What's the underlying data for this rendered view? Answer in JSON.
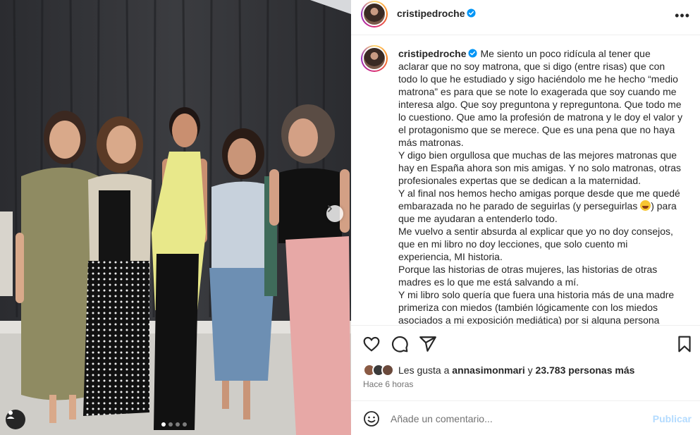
{
  "post": {
    "username": "cristipedroche",
    "verified": true,
    "more_icon": "more-horizontal-icon",
    "carousel": {
      "slide_count": 4,
      "active_index": 0
    }
  },
  "caption": {
    "username": "cristipedroche",
    "paragraphs": [
      "Me siento un poco ridícula al tener que aclarar que no soy matrona, que si digo (entre risas) que con todo lo que he estudiado y sigo haciéndolo me he hecho “medio matrona” es para que se note lo exagerada que soy cuando me interesa algo. Que soy preguntona y repreguntona. Que todo me lo cuestiono. Que amo la profesión de matrona y le doy el valor y el protagonismo que se merece. Que es una pena que no haya más matronas.",
      "Y digo bien orgullosa que muchas de las mejores matronas que hay en España ahora son mis amigas. Y no solo matronas, otras profesionales expertas que se dedican a la maternidad.",
      "Y al final nos hemos hecho amigas porque desde que me quedé embarazada no he parado de seguirlas (y perseguirlas",
      ") para que me ayudaran a entenderlo todo.",
      "Me vuelvo a sentir absurda al explicar que yo no doy consejos, que en mi libro no doy lecciones, que solo cuento mi experiencia, MI historia.",
      "Porque las historias de otras mujeres, las historias de otras madres es lo que me está salvando a mí.",
      "Y mi libro solo quería que fuera una historia más de una madre primeriza con miedos (también lógicamente con los miedos asociados a mi exposición mediática) por si alguna persona"
    ]
  },
  "likes": {
    "prefix": "Les gusta a",
    "user": "annasimonmari",
    "connector": "y",
    "others": "23.783 personas más"
  },
  "time_ago": "Hace 6 horas",
  "comment": {
    "placeholder": "Añade un comentario...",
    "post_label": "Publicar"
  },
  "colors": {
    "verified": "#0095f6",
    "post_disabled": "#b3dbff",
    "secondary_text": "#737373"
  }
}
